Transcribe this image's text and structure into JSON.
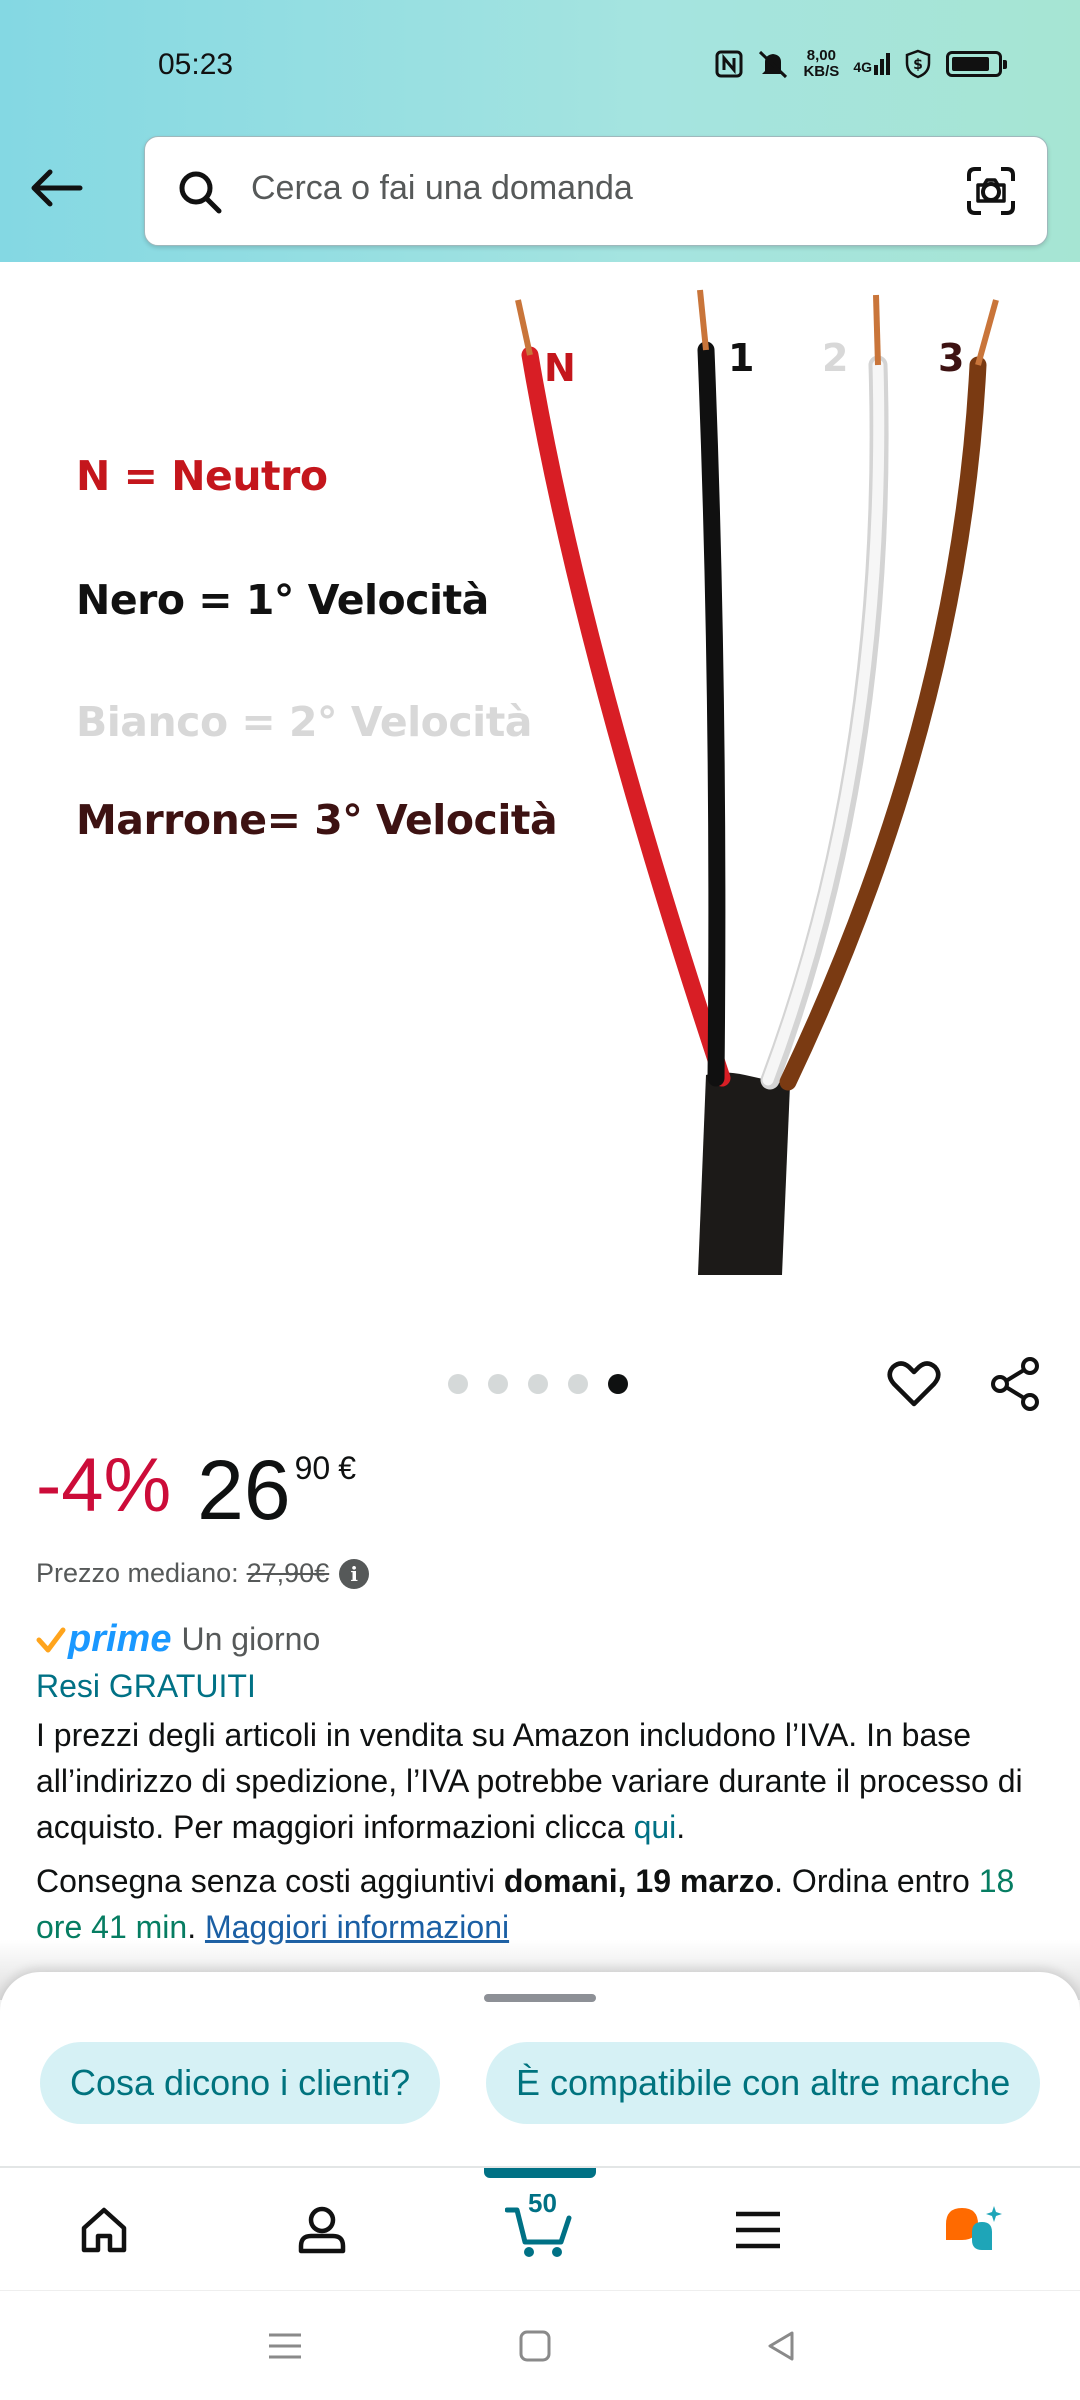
{
  "status_bar": {
    "time": "05:23",
    "net_speed_value": "8,00",
    "net_speed_unit": "KB/S",
    "network": "4G",
    "battery_level": 0.85
  },
  "search": {
    "placeholder": "Cerca o fai una domanda"
  },
  "product_image": {
    "legend": [
      {
        "text": "N = Neutro",
        "color": "#c4161c"
      },
      {
        "text": "Nero = 1° Velocità",
        "color": "#111111"
      },
      {
        "text": "Bianco = 2° Velocità",
        "color": "#d8d8d8"
      },
      {
        "text": "Marrone= 3° Velocità",
        "color": "#3d1212"
      }
    ],
    "wire_labels": [
      {
        "text": "N",
        "color": "#c4161c"
      },
      {
        "text": "1",
        "color": "#111111"
      },
      {
        "text": "2",
        "color": "#d8d8d8"
      },
      {
        "text": "3",
        "color": "#3d1212"
      }
    ],
    "carousel_total": 5,
    "carousel_active": 5
  },
  "price": {
    "discount": "-4%",
    "whole": "26",
    "fraction": "90",
    "currency": "€",
    "median_label": "Prezzo mediano:",
    "median_value": "27,90€"
  },
  "prime": {
    "logo_text": "prime",
    "delivery": "Un giorno"
  },
  "returns": "Resi GRATUITI",
  "vat": {
    "text": "I prezzi degli articoli in vendita su Amazon includono l’IVA. In base all’indirizzo di spedizione, l’IVA potrebbe variare durante il processo di acquisto. Per maggiori informazioni clicca ",
    "link": "qui",
    "end": "."
  },
  "delivery": {
    "prefix": "Consegna senza costi aggiuntivi ",
    "date": "domani, 19 marzo",
    "middle": ". Ordina entro ",
    "countdown": "18 ore 41 min",
    "sep": ". ",
    "link": "Maggiori informazioni"
  },
  "chips": [
    "Cosa dicono i clienti?",
    "È compatibile con altre marche"
  ],
  "bottom_nav": {
    "cart_count": "50",
    "items": [
      "home-icon",
      "account-icon",
      "cart-icon",
      "menu-icon",
      "rufus-icon"
    ]
  },
  "colors": {
    "accent": "#007185",
    "discount": "#cc0c39",
    "prime_blue": "#1a98ff",
    "chip_bg": "#d6f1f5"
  }
}
